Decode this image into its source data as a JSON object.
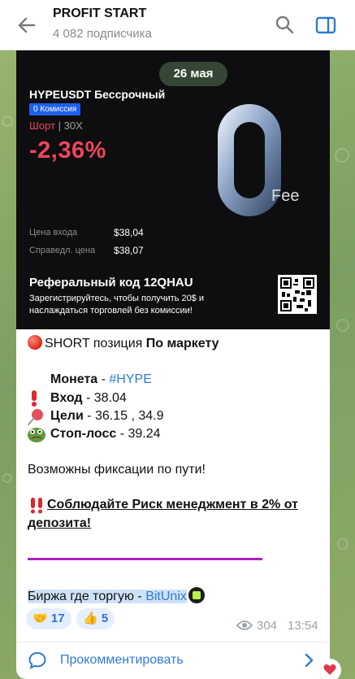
{
  "header": {
    "title": "PROFIT START",
    "subtitle": "4 082 подписчика"
  },
  "banner": {
    "date": "26 мая",
    "pair": "HYPEUSDT Бессрочный",
    "commission": "0 Комиссия",
    "side": "Шорт",
    "leverage": "30X",
    "pnl": "-2,36%",
    "fee_label": "Fee",
    "entry_label": "Цена входа",
    "entry_value": "$38,04",
    "fair_label": "Справедл. цена",
    "fair_value": "$38,07",
    "ref_title": "Реферальный код 12QHAU",
    "ref_text": "Зарегистрируйтесь, чтобы получить 20$ и наслаждаться торговлей без комиссии!"
  },
  "message": {
    "line1_pre": "SHORT позиция ",
    "line1_bold": "По маркету",
    "coin_label": "Монета",
    "coin_sep": " - ",
    "coin_value": "#HYPE",
    "entry_label": "Вход",
    "entry_value": " - 38.04",
    "targets_label": "Цели",
    "targets_value": " -  36.15 , 34.9",
    "stop_label": "Стоп-лосс",
    "stop_value": " - 39.24",
    "fixations": "Возможны фиксации по пути!",
    "risk_line1": "Соблюдайте Риск менеджмент в 2% от",
    "risk_line2": "депозита!",
    "exchange_label": "Биржа где торгую - ",
    "exchange_link": "BitUnix"
  },
  "reactions": [
    {
      "emoji": "🤝",
      "count": "17"
    },
    {
      "emoji": "👍",
      "count": "5"
    }
  ],
  "meta": {
    "views": "304",
    "time": "13:54"
  },
  "comment": {
    "label": "Прокомментировать"
  },
  "colors": {
    "accent": "#2f7bd1",
    "short_red": "#f0455a",
    "divider": "#b021c2"
  }
}
